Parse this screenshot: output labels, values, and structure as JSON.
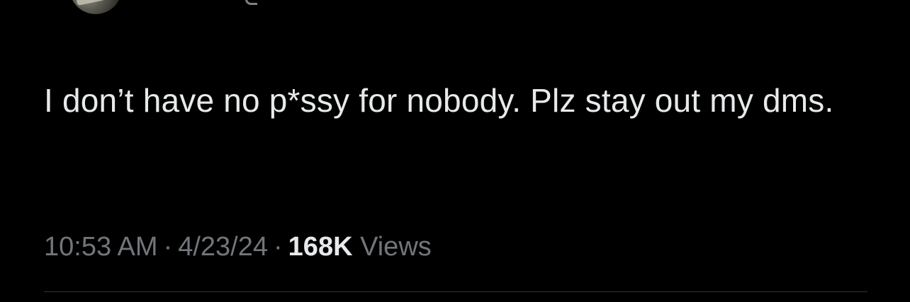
{
  "tweet": {
    "text": "I don’t have no p*ssy for nobody. Plz stay out my dms.",
    "time": "10:53 AM",
    "separator": "·",
    "date": "4/23/24",
    "views_count": "168K",
    "views_label": "Views"
  },
  "colors": {
    "background": "#000000",
    "primary_text": "#e7e9ea",
    "secondary_text": "#71767b",
    "divider": "#2f3336"
  }
}
